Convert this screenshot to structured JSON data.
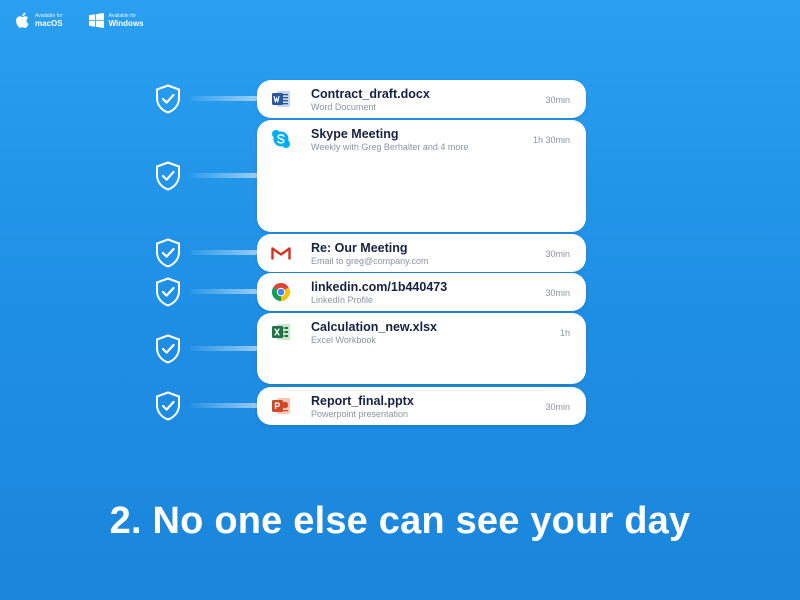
{
  "platforms": [
    {
      "small": "Available for",
      "big": "macOS",
      "icon": "apple-icon"
    },
    {
      "small": "Available for",
      "big": "Windows",
      "icon": "windows-icon"
    }
  ],
  "items": [
    {
      "title": "Contract_draft.docx",
      "subtitle": "Word Document",
      "duration": "30min",
      "icon": "word-icon"
    },
    {
      "title": "Skype Meeting",
      "subtitle": "Weekly with Greg Berhalter and 4 more",
      "duration": "1h 30min",
      "icon": "skype-icon"
    },
    {
      "title": "Re: Our Meeting",
      "subtitle": "Email to greg@company.com",
      "duration": "30min",
      "icon": "gmail-icon"
    },
    {
      "title": "linkedin.com/1b440473",
      "subtitle": "LinkedIn Profile",
      "duration": "30min",
      "icon": "chrome-icon"
    },
    {
      "title": "Calculation_new.xlsx",
      "subtitle": "Excel Workbook",
      "duration": "1h",
      "icon": "excel-icon"
    },
    {
      "title": "Report_final.pptx",
      "subtitle": "Powerpoint presentation",
      "duration": "30min",
      "icon": "powerpoint-icon"
    }
  ],
  "headline": "2.  No one else can see your day",
  "colors": {
    "background": "#2196ea",
    "title_text": "#172144",
    "muted_text": "#8a93a6",
    "word": "#2b5797",
    "skype": "#00aff0",
    "gmail": "#d93025",
    "excel": "#1e7145",
    "powerpoint": "#d24726"
  }
}
